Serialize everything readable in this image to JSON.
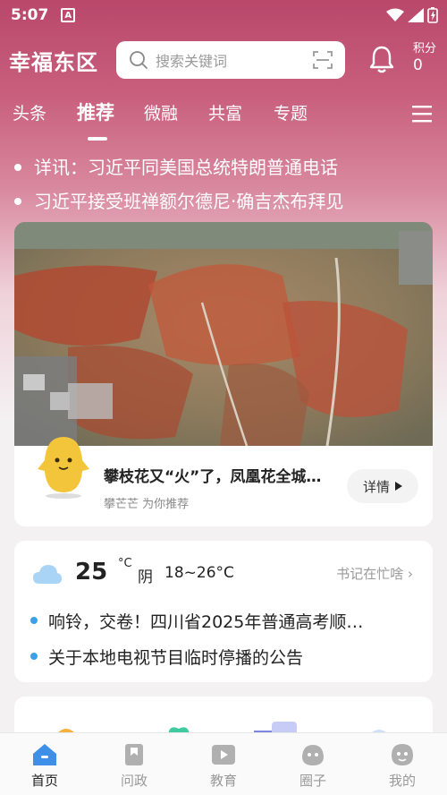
{
  "status_bar": {
    "time": "5:07",
    "app_badge": "A"
  },
  "header": {
    "title": "幸福东区",
    "search_placeholder": "搜索关键词",
    "points_label": "积分",
    "points_value": "0"
  },
  "tabs": [
    {
      "label": "头条"
    },
    {
      "label": "推荐",
      "active": true
    },
    {
      "label": "微融"
    },
    {
      "label": "共富"
    },
    {
      "label": "专题"
    }
  ],
  "headlines": [
    "详讯：习近平同美国总统特朗普通电话",
    "习近平接受班禅额尔德尼·确吉杰布拜见"
  ],
  "feature_card": {
    "title": "攀枝花又“火”了，凤凰花全城…",
    "subtitle": "攀芒芒 为你推荐",
    "detail_label": "详情"
  },
  "weather_card": {
    "temperature": "25",
    "unit": "°C",
    "condition": "阴",
    "range": "18~26°C",
    "link_label": "书记在忙啥",
    "notices": [
      "响铃，交卷！四川省2025年普通高考顺…",
      "关于本地电视节目临时停播的公告"
    ]
  },
  "bottom_nav": [
    {
      "label": "首页",
      "icon": "home-icon",
      "active": true
    },
    {
      "label": "问政",
      "icon": "bookmark-icon"
    },
    {
      "label": "教育",
      "icon": "play-icon"
    },
    {
      "label": "圈子",
      "icon": "mascot-icon"
    },
    {
      "label": "我的",
      "icon": "profile-icon"
    }
  ],
  "colors": {
    "accent": "#3da0e8",
    "hero": "#c85e7c"
  }
}
